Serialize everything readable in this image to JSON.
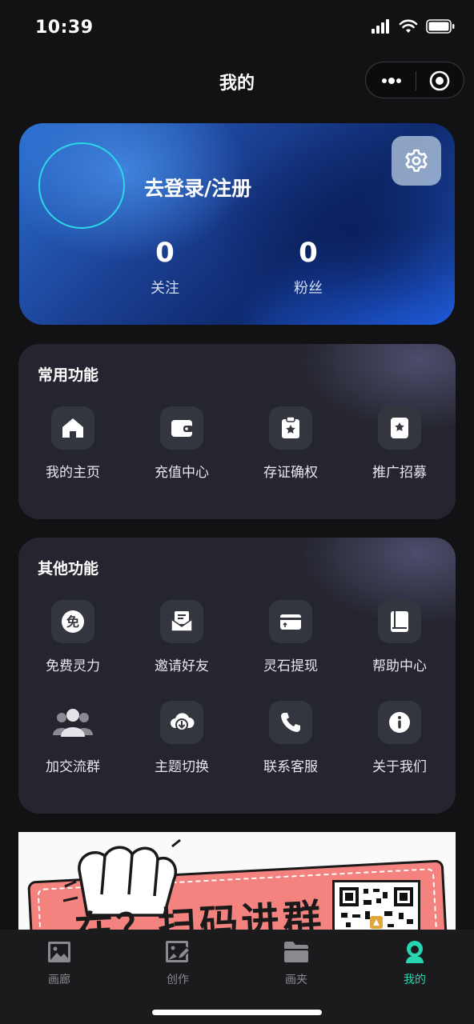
{
  "status_bar": {
    "time": "10:39"
  },
  "nav": {
    "title": "我的"
  },
  "profile": {
    "login_text": "去登录/注册",
    "stats": [
      {
        "value": "0",
        "label": "关注"
      },
      {
        "value": "0",
        "label": "粉丝"
      }
    ]
  },
  "common_functions": {
    "title": "常用功能",
    "items": [
      {
        "label": "我的主页",
        "icon": "home-icon"
      },
      {
        "label": "充值中心",
        "icon": "wallet-icon"
      },
      {
        "label": "存证确权",
        "icon": "certificate-icon"
      },
      {
        "label": "推广招募",
        "icon": "bookmark-star-icon"
      }
    ]
  },
  "other_functions": {
    "title": "其他功能",
    "items": [
      {
        "label": "免费灵力",
        "icon": "free-badge-icon"
      },
      {
        "label": "邀请好友",
        "icon": "invite-mail-icon"
      },
      {
        "label": "灵石提现",
        "icon": "withdraw-card-icon"
      },
      {
        "label": "帮助中心",
        "icon": "book-icon"
      },
      {
        "label": "加交流群",
        "icon": "group-icon"
      },
      {
        "label": "主题切换",
        "icon": "cloud-download-icon"
      },
      {
        "label": "联系客服",
        "icon": "phone-icon"
      },
      {
        "label": "关于我们",
        "icon": "info-icon"
      }
    ]
  },
  "banner": {
    "text": "在？扫码进群"
  },
  "tab_bar": {
    "tabs": [
      {
        "label": "画廊",
        "icon": "image-icon",
        "active": false
      },
      {
        "label": "创作",
        "icon": "edit-image-icon",
        "active": false
      },
      {
        "label": "画夹",
        "icon": "folder-icon",
        "active": false
      },
      {
        "label": "我的",
        "icon": "user-icon",
        "active": true
      }
    ]
  },
  "colors": {
    "accent": "#27d6b0",
    "avatar_ring": "#2ad8e8",
    "card_bg": "#24252e"
  }
}
